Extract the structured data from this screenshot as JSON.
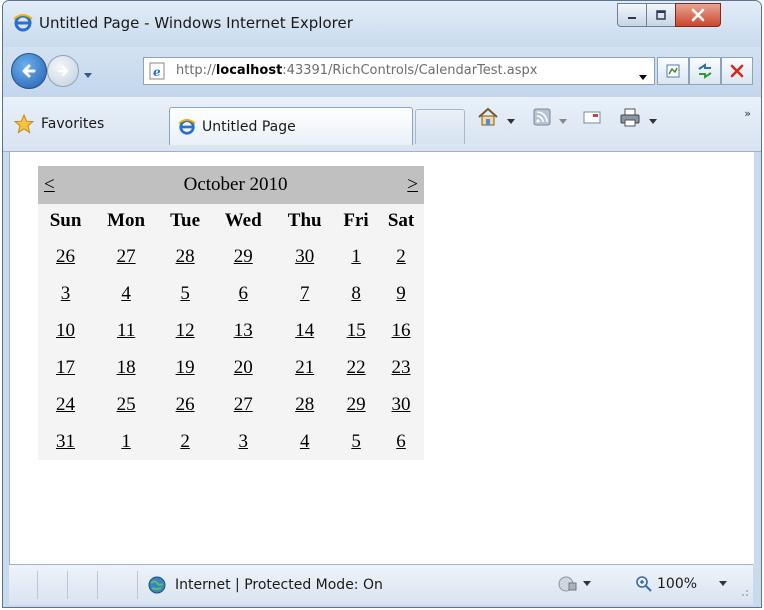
{
  "window": {
    "title": "Untitled Page - Windows Internet Explorer"
  },
  "address": {
    "url_prefix": "http://",
    "url_host": "localhost",
    "url_rest": ":43391/RichControls/CalendarTest.aspx"
  },
  "toolbar": {
    "favorites_label": "Favorites",
    "tab_label": "Untitled Page",
    "overflow": "»"
  },
  "calendar": {
    "prev": "<",
    "next": ">",
    "month_title": "October 2010",
    "weekdays": [
      "Sun",
      "Mon",
      "Tue",
      "Wed",
      "Thu",
      "Fri",
      "Sat"
    ],
    "weeks": [
      [
        "26",
        "27",
        "28",
        "29",
        "30",
        "1",
        "2"
      ],
      [
        "3",
        "4",
        "5",
        "6",
        "7",
        "8",
        "9"
      ],
      [
        "10",
        "11",
        "12",
        "13",
        "14",
        "15",
        "16"
      ],
      [
        "17",
        "18",
        "19",
        "20",
        "21",
        "22",
        "23"
      ],
      [
        "24",
        "25",
        "26",
        "27",
        "28",
        "29",
        "30"
      ],
      [
        "31",
        "1",
        "2",
        "3",
        "4",
        "5",
        "6"
      ]
    ]
  },
  "status": {
    "zone": "Internet | Protected Mode: On",
    "zoom": "100%"
  },
  "colors": {
    "title_bar": "#c9dbee",
    "close_button": "#c9472e",
    "calendar_header": "#c0c0c0",
    "calendar_body": "#f4f4f4"
  }
}
